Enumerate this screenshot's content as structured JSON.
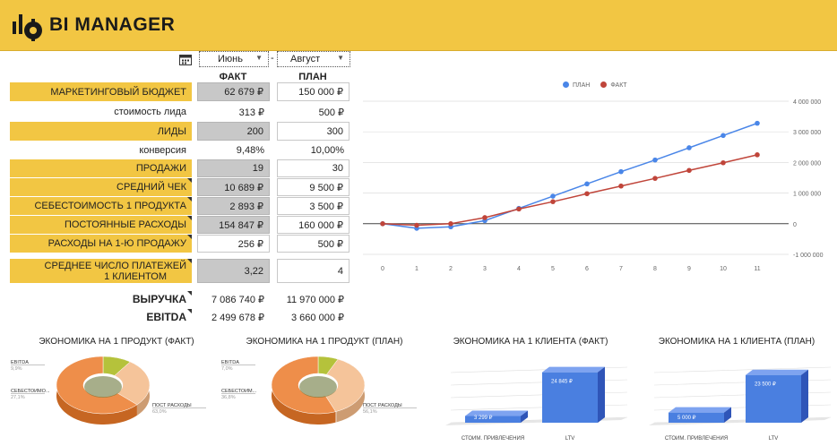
{
  "header": {
    "brand": "BI MANAGER",
    "logo_icon": "bi-manager-logo-icon"
  },
  "filters": {
    "from_month": "Июнь",
    "to_month": "Август",
    "separator": "-"
  },
  "columns": {
    "fact": "ФАКТ",
    "plan": "ПЛАН"
  },
  "rows": {
    "marketing_budget": {
      "label": "МАРКЕТИНГОВЫЙ БЮДЖЕТ",
      "fact": "62 679 ₽",
      "plan": "150 000 ₽"
    },
    "lead_cost": {
      "label": "стоимость лида",
      "fact": "313 ₽",
      "plan": "500 ₽"
    },
    "leads": {
      "label": "ЛИДЫ",
      "fact": "200",
      "plan": "300"
    },
    "conversion": {
      "label": "конверсия",
      "fact": "9,48%",
      "plan": "10,00%"
    },
    "sales": {
      "label": "ПРОДАЖИ",
      "fact": "19",
      "plan": "30"
    },
    "avg_check": {
      "label": "СРЕДНИЙ ЧЕК",
      "fact": "10 689 ₽",
      "plan": "9 500 ₽"
    },
    "unit_cost": {
      "label": "СЕБЕСТОИМОСТЬ 1 ПРОДУКТА",
      "fact": "2 893 ₽",
      "plan": "3 500 ₽"
    },
    "fixed_costs": {
      "label": "ПОСТОЯННЫЕ РАСХОДЫ",
      "fact": "154 847 ₽",
      "plan": "160 000 ₽"
    },
    "first_sale_costs": {
      "label": "РАСХОДЫ НА 1-Ю ПРОДАЖУ",
      "fact": "256 ₽",
      "plan": "500 ₽"
    },
    "avg_payments": {
      "label_line1": "СРЕДНЕЕ ЧИСЛО ПЛАТЕЖЕЙ",
      "label_line2": "1 КЛИЕНТОМ",
      "fact": "3,22",
      "plan": "4"
    },
    "revenue": {
      "label": "ВЫРУЧКА",
      "fact": "7 086 740 ₽",
      "plan": "11 970 000 ₽"
    },
    "ebitda": {
      "label": "EBITDA",
      "fact": "2 499 678 ₽",
      "plan": "3 660 000 ₽"
    }
  },
  "colors": {
    "header": "#f2c643",
    "plan_line": "#4a86e8",
    "fact_line": "#c0453a",
    "bar": "#4a7fe0"
  },
  "chart_data": [
    {
      "type": "line",
      "x": [
        0,
        1,
        2,
        3,
        4,
        5,
        6,
        7,
        8,
        9,
        10,
        11
      ],
      "series": [
        {
          "name": "ПЛАН",
          "values": [
            0,
            -150000,
            -100000,
            100000,
            500000,
            900000,
            1300000,
            1700000,
            2080000,
            2480000,
            2880000,
            3280000
          ]
        },
        {
          "name": "ФАКТ",
          "values": [
            0,
            -50000,
            0,
            200000,
            480000,
            720000,
            980000,
            1230000,
            1480000,
            1740000,
            1990000,
            2250000
          ]
        }
      ],
      "y_ticks": [
        "4 000 000",
        "3 000 000",
        "2 000 000",
        "1 000 000",
        "0",
        "-1 000 000"
      ],
      "x_ticks": [
        "0",
        "1",
        "2",
        "3",
        "4",
        "5",
        "6",
        "7",
        "8",
        "9",
        "10",
        "11"
      ],
      "ylim": [
        -1000000,
        4000000
      ],
      "legend": "top"
    },
    {
      "type": "pie",
      "title": "ЭКОНОМИКА НА 1 ПРОДУКТ (ФАКТ)",
      "slices": [
        {
          "label": "EBITDA",
          "pct": "9,9%",
          "value": 9.9,
          "color": "#b5c23b"
        },
        {
          "label": "СЕБЕСТОИМО...",
          "pct": "27,1%",
          "value": 27.1,
          "color": "#f5c49a"
        },
        {
          "label": "ПОСТ РАСХОДЫ",
          "pct": "63,0%",
          "value": 63.0,
          "color": "#ee8e4a"
        }
      ]
    },
    {
      "type": "pie",
      "title": "ЭКОНОМИКА НА 1 ПРОДУКТ (ПЛАН)",
      "slices": [
        {
          "label": "EBITDA",
          "pct": "7,0%",
          "value": 7.0,
          "color": "#b5c23b"
        },
        {
          "label": "СЕБЕСТОИМ...",
          "pct": "36,8%",
          "value": 36.8,
          "color": "#f5c49a"
        },
        {
          "label": "ПОСТ РАСХОДЫ",
          "pct": "56,1%",
          "value": 56.1,
          "color": "#ee8e4a"
        }
      ]
    },
    {
      "type": "bar",
      "title": "ЭКОНОМИКА НА 1 КЛИЕНТА (ФАКТ)",
      "categories": [
        "СТОИМ. ПРИВЛЕЧЕНИЯ",
        "LTV"
      ],
      "values": [
        3299,
        24845
      ],
      "labels": [
        "3 299 ₽",
        "24 845 ₽"
      ]
    },
    {
      "type": "bar",
      "title": "ЭКОНОМИКА НА 1 КЛИЕНТА (ПЛАН)",
      "categories": [
        "СТОИМ. ПРИВЛЕЧЕНИЯ",
        "LTV"
      ],
      "values": [
        5000,
        23500
      ],
      "labels": [
        "5 000 ₽",
        "23 500 ₽"
      ]
    }
  ]
}
